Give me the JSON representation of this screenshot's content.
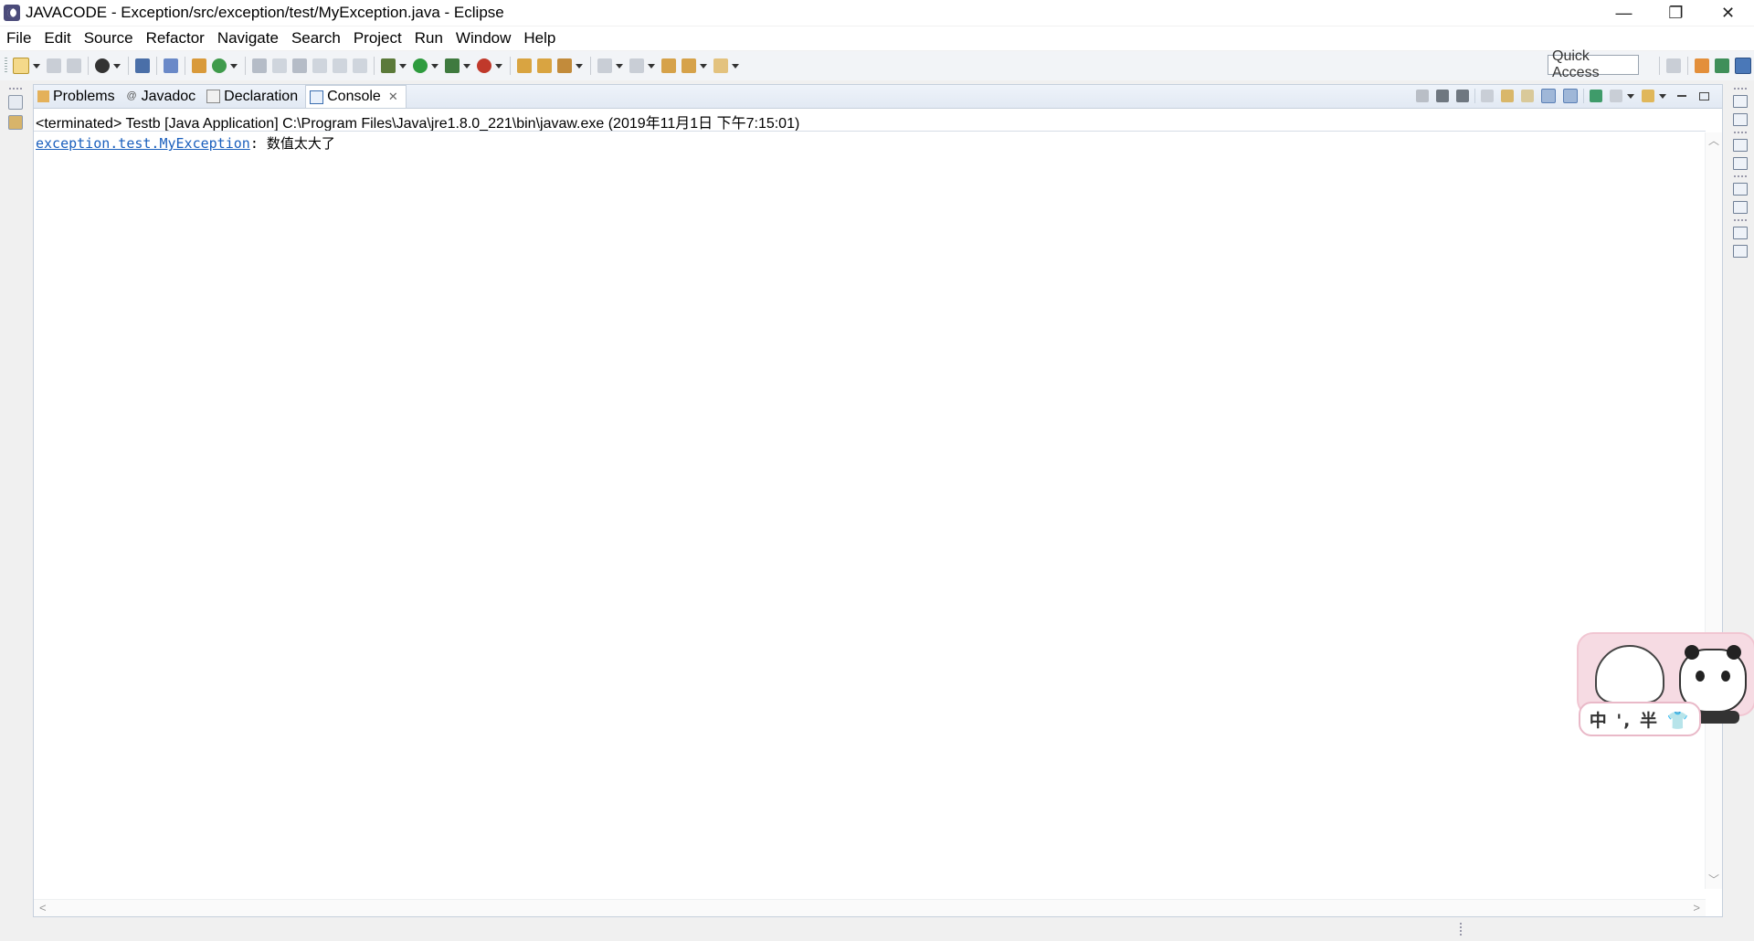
{
  "window": {
    "title": "JAVACODE - Exception/src/exception/test/MyException.java - Eclipse",
    "minimize": "—",
    "restore": "❐",
    "close": "✕"
  },
  "menu": [
    "File",
    "Edit",
    "Source",
    "Refactor",
    "Navigate",
    "Search",
    "Project",
    "Run",
    "Window",
    "Help"
  ],
  "toolbar": {
    "quick_access_placeholder": "Quick Access"
  },
  "view": {
    "tabs": [
      {
        "label": "Problems",
        "icon": "problems-icon"
      },
      {
        "label": "Javadoc",
        "icon": "javadoc-icon"
      },
      {
        "label": "Declaration",
        "icon": "declaration-icon"
      },
      {
        "label": "Console",
        "icon": "console-icon",
        "active": true
      }
    ],
    "process_label": "<terminated> Testb [Java Application] C:\\Program Files\\Java\\jre1.8.0_221\\bin\\javaw.exe (2019年11月1日 下午7:15:01)",
    "console": {
      "exception_link": "exception.test.MyException",
      "message_sep": ": ",
      "message": "数值太大了"
    }
  },
  "ime": {
    "text": "中 ', 半 👕"
  },
  "colors": {
    "link": "#1a5fbd",
    "tab_bar": "#e2e9f3",
    "ime_pink": "#f6dbe3"
  }
}
